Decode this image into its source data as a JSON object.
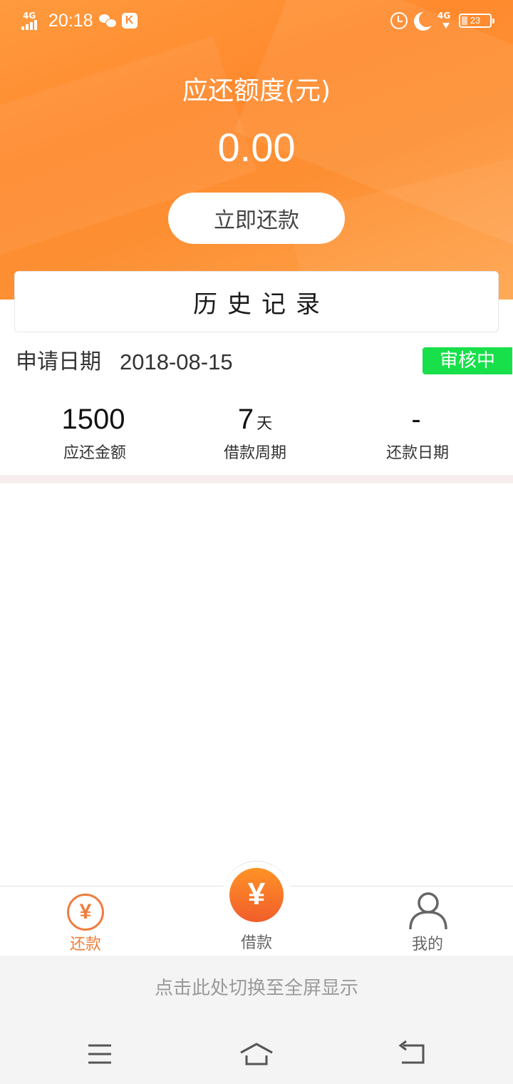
{
  "status_bar": {
    "network_left": "4G",
    "time": "20:18",
    "network_right": "4G",
    "battery": "23"
  },
  "header": {
    "title": "应还额度(元)",
    "amount": "0.00",
    "repay_button": "立即还款"
  },
  "history": {
    "title": "历史记录"
  },
  "record": {
    "apply_label": "申请日期",
    "apply_date": "2018-08-15",
    "status": "审核中",
    "stats": [
      {
        "value": "1500",
        "unit": "",
        "label": "应还金额"
      },
      {
        "value": "7",
        "unit": "天",
        "label": "借款周期"
      },
      {
        "value": "-",
        "unit": "",
        "label": "还款日期"
      }
    ]
  },
  "tabbar": {
    "repay": {
      "label": "还款",
      "icon": "yen-coin-outline-icon"
    },
    "borrow": {
      "label": "借款",
      "icon": "yen-coin-filled-icon"
    },
    "mine": {
      "label": "我的",
      "icon": "person-icon"
    },
    "coin_symbol": "¥"
  },
  "system_bar": {
    "fullscreen_hint": "点击此处切换至全屏显示"
  },
  "colors": {
    "accent": "#ff8c33",
    "status_green": "#17e04a",
    "tab_active": "#ef7d3c"
  }
}
